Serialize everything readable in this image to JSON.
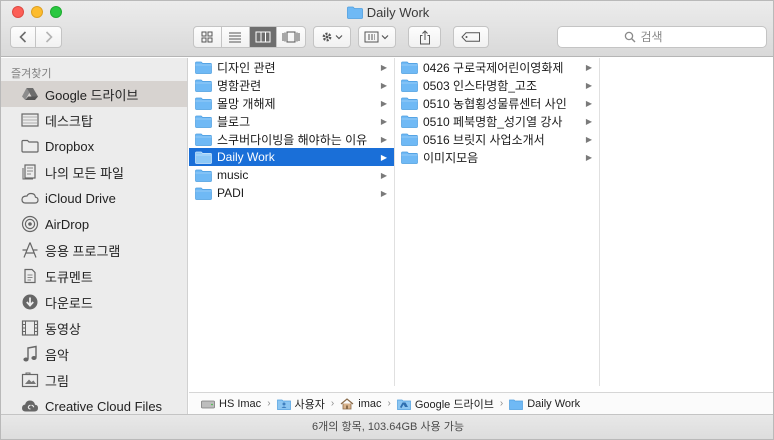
{
  "window": {
    "title": "Daily Work"
  },
  "toolbar": {
    "search_placeholder": "검색"
  },
  "sidebar": {
    "heading": "즐겨찾기",
    "items": [
      {
        "label": "Google 드라이브",
        "icon": "google-drive-icon",
        "selected": true
      },
      {
        "label": "데스크탑",
        "icon": "desktop-icon",
        "selected": false
      },
      {
        "label": "Dropbox",
        "icon": "folder-icon",
        "selected": false
      },
      {
        "label": "나의 모든 파일",
        "icon": "all-files-icon",
        "selected": false
      },
      {
        "label": "iCloud Drive",
        "icon": "cloud-icon",
        "selected": false
      },
      {
        "label": "AirDrop",
        "icon": "airdrop-icon",
        "selected": false
      },
      {
        "label": "응용 프로그램",
        "icon": "applications-icon",
        "selected": false
      },
      {
        "label": "도큐멘트",
        "icon": "documents-icon",
        "selected": false
      },
      {
        "label": "다운로드",
        "icon": "downloads-icon",
        "selected": false
      },
      {
        "label": "동영상",
        "icon": "movies-icon",
        "selected": false
      },
      {
        "label": "음악",
        "icon": "music-icon",
        "selected": false
      },
      {
        "label": "그림",
        "icon": "pictures-icon",
        "selected": false
      },
      {
        "label": "Creative Cloud Files",
        "icon": "creative-cloud-icon",
        "selected": false
      }
    ]
  },
  "columns": [
    {
      "items": [
        {
          "name": "디자인 관련",
          "selected": false
        },
        {
          "name": "명함관련",
          "selected": false
        },
        {
          "name": "몰망 개해제",
          "selected": false
        },
        {
          "name": "블로그",
          "selected": false
        },
        {
          "name": "스쿠버다이빙을 해야하는 이유",
          "selected": false
        },
        {
          "name": "Daily Work",
          "selected": true
        },
        {
          "name": "music",
          "selected": false
        },
        {
          "name": "PADI",
          "selected": false
        }
      ]
    },
    {
      "items": [
        {
          "name": "0426 구로국제어린이영화제",
          "selected": false
        },
        {
          "name": "0503 인스타명함_고조",
          "selected": false
        },
        {
          "name": "0510 농협횡성물류센터 사인",
          "selected": false
        },
        {
          "name": "0510 페북명함_성기열 강사",
          "selected": false
        },
        {
          "name": "0516 브릿지 사업소개서",
          "selected": false
        },
        {
          "name": "이미지모음",
          "selected": false
        }
      ]
    }
  ],
  "pathbar": {
    "segments": [
      {
        "label": "HS Imac",
        "icon": "hard-drive-icon"
      },
      {
        "label": "사용자",
        "icon": "users-folder-icon"
      },
      {
        "label": "imac",
        "icon": "home-icon"
      },
      {
        "label": "Google 드라이브",
        "icon": "google-drive-icon"
      },
      {
        "label": "Daily Work",
        "icon": "folder-icon"
      }
    ]
  },
  "status": {
    "text": "6개의 항목, 103.64GB 사용 가능"
  },
  "colors": {
    "selection": "#1a6fd8",
    "folder": "#6fb9f5",
    "sidebar_bg": "#ececec"
  }
}
